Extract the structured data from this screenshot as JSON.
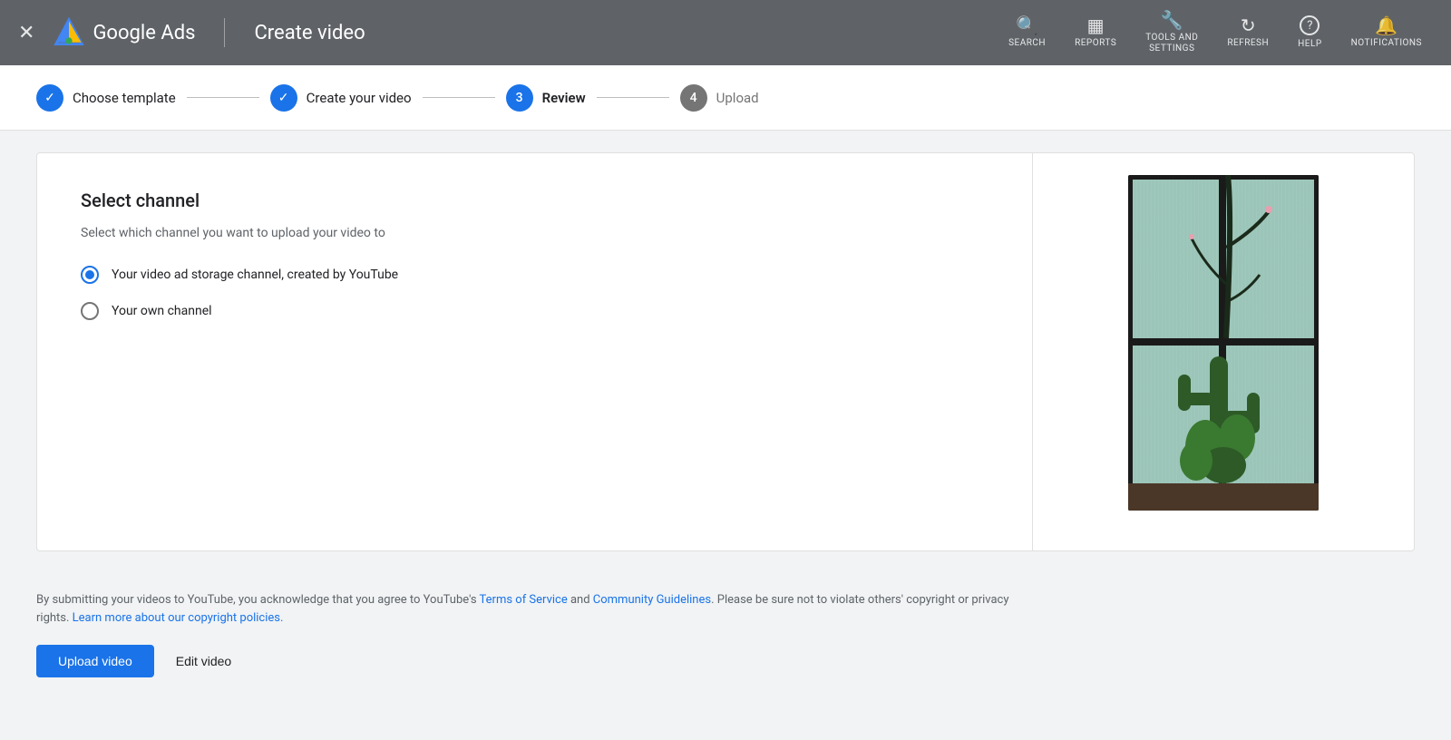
{
  "header": {
    "close_label": "✕",
    "app_name": "Google Ads",
    "page_title": "Create video",
    "actions": [
      {
        "id": "search",
        "icon": "🔍",
        "label": "SEARCH"
      },
      {
        "id": "reports",
        "icon": "📊",
        "label": "REPORTS"
      },
      {
        "id": "tools",
        "icon": "🔧",
        "label": "TOOLS AND\nSETTINGS"
      },
      {
        "id": "refresh",
        "icon": "↻",
        "label": "REFRESH"
      },
      {
        "id": "help",
        "icon": "?",
        "label": "HELP"
      },
      {
        "id": "notifications",
        "icon": "🔔",
        "label": "NOTIFICATIONS"
      }
    ]
  },
  "stepper": {
    "steps": [
      {
        "id": "choose-template",
        "number": "✓",
        "label": "Choose template",
        "state": "completed"
      },
      {
        "id": "create-video",
        "number": "✓",
        "label": "Create your video",
        "state": "completed"
      },
      {
        "id": "review",
        "number": "3",
        "label": "Review",
        "state": "active"
      },
      {
        "id": "upload",
        "number": "4",
        "label": "Upload",
        "state": "inactive"
      }
    ]
  },
  "main": {
    "select_channel": {
      "title": "Select channel",
      "description": "Select which channel you want to upload your video to",
      "options": [
        {
          "id": "storage-channel",
          "label": "Your video ad storage channel, created by YouTube",
          "selected": true
        },
        {
          "id": "own-channel",
          "label": "Your own channel",
          "selected": false
        }
      ]
    }
  },
  "footer": {
    "disclaimer_parts": {
      "before_tos": "By submitting your videos to YouTube, you acknowledge that you agree to YouTube's ",
      "tos_label": "Terms of Service",
      "between": " and ",
      "cg_label": "Community Guidelines",
      "after_cg": ". Please be sure not to violate others' copyright or privacy rights. ",
      "copyright_link": "Learn more about our copyright policies."
    },
    "buttons": {
      "upload": "Upload video",
      "edit": "Edit video"
    }
  }
}
